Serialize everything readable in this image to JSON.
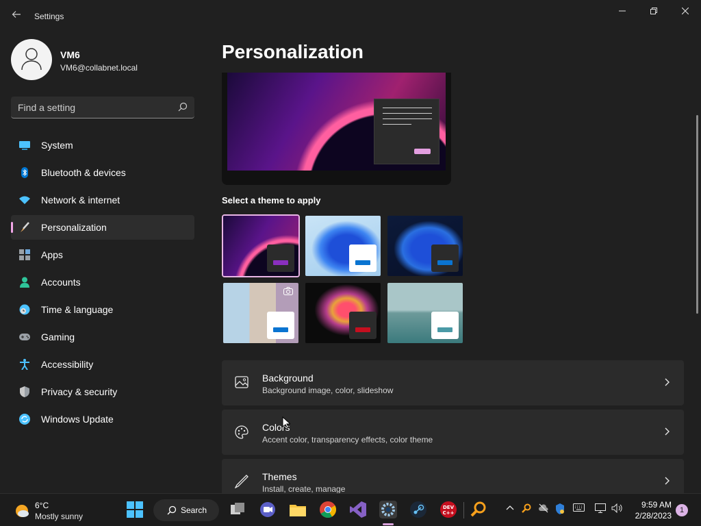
{
  "window": {
    "title": "Settings",
    "back_icon": "back-arrow-icon",
    "controls": [
      "minimize-icon",
      "restore-icon",
      "close-icon"
    ]
  },
  "user": {
    "name": "VM6",
    "email": "VM6@collabnet.local"
  },
  "search": {
    "placeholder": "Find a setting"
  },
  "sidebar": {
    "items": [
      {
        "label": "System",
        "icon": "display-icon",
        "color": "#4cc2ff"
      },
      {
        "label": "Bluetooth & devices",
        "icon": "bluetooth-icon",
        "color": "#0078d4"
      },
      {
        "label": "Network & internet",
        "icon": "wifi-icon",
        "color": "#4cc2ff"
      },
      {
        "label": "Personalization",
        "icon": "brush-icon",
        "color": "#e8a95c",
        "selected": true
      },
      {
        "label": "Apps",
        "icon": "apps-icon",
        "color": "#9aa0a6"
      },
      {
        "label": "Accounts",
        "icon": "person-icon",
        "color": "#2fc59a"
      },
      {
        "label": "Time & language",
        "icon": "globe-clock-icon",
        "color": "#4cc2ff"
      },
      {
        "label": "Gaming",
        "icon": "controller-icon",
        "color": "#9aa0a6"
      },
      {
        "label": "Accessibility",
        "icon": "accessibility-icon",
        "color": "#4cc2ff"
      },
      {
        "label": "Privacy & security",
        "icon": "shield-icon",
        "color": "#9aa0a6"
      },
      {
        "label": "Windows Update",
        "icon": "update-icon",
        "color": "#4cc2ff"
      }
    ]
  },
  "main": {
    "title": "Personalization",
    "theme_section_label": "Select a theme to apply",
    "themes": [
      {
        "name": "dark-bloom",
        "swatch_box": "#2b2b2b",
        "swatch_bar": "#8a2fbf",
        "selected": true
      },
      {
        "name": "light-bloom",
        "swatch_box": "#ffffff",
        "swatch_bar": "#0a74d1"
      },
      {
        "name": "dark-blue-bloom",
        "swatch_box": "#2b2b2b",
        "swatch_bar": "#0a74d1"
      },
      {
        "name": "flowers",
        "swatch_box": "#ffffff",
        "swatch_bar": "#0a74d1",
        "icon": "camera-icon"
      },
      {
        "name": "glow",
        "swatch_box": "#2b2b2b",
        "swatch_bar": "#c50f1f"
      },
      {
        "name": "captured-motion",
        "swatch_box": "#ffffff",
        "swatch_bar": "#4a9aa6"
      }
    ],
    "cards": [
      {
        "title": "Background",
        "subtitle": "Background image, color, slideshow",
        "icon": "image-icon"
      },
      {
        "title": "Colors",
        "subtitle": "Accent color, transparency effects, color theme",
        "icon": "palette-icon"
      },
      {
        "title": "Themes",
        "subtitle": "Install, create, manage",
        "icon": "pen-icon"
      }
    ]
  },
  "taskbar": {
    "weather": {
      "temp": "6°C",
      "description": "Mostly sunny"
    },
    "search_label": "Search",
    "clock": {
      "time": "9:59 AM",
      "date": "2/28/2023"
    },
    "notification_count": "1"
  }
}
